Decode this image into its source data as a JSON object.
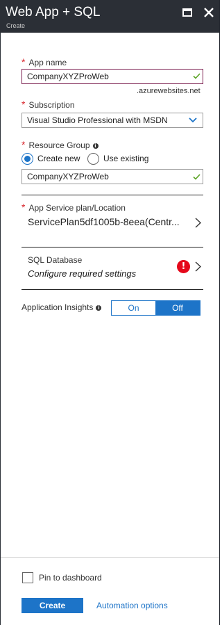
{
  "header": {
    "title": "Web App + SQL",
    "subtitle": "Create"
  },
  "form": {
    "app_name": {
      "label": "App name",
      "value": "CompanyXYZProWeb",
      "suffix": ".azurewebsites.net"
    },
    "subscription": {
      "label": "Subscription",
      "value": "Visual Studio Professional with MSDN"
    },
    "resource_group": {
      "label": "Resource Group",
      "options": [
        "Create new",
        "Use existing"
      ],
      "selected": "Create new",
      "value": "CompanyXYZProWeb"
    },
    "app_service_plan": {
      "label": "App Service plan/Location",
      "value": "ServicePlan5df1005b-8eea(Centr..."
    },
    "sql_database": {
      "label": "SQL Database",
      "value": "Configure required settings",
      "status": "error"
    },
    "app_insights": {
      "label": "Application Insights",
      "on_label": "On",
      "off_label": "Off",
      "selected": "Off"
    }
  },
  "footer": {
    "pin_label": "Pin to dashboard",
    "pin_checked": false,
    "create_label": "Create",
    "automation_label": "Automation options"
  },
  "colors": {
    "header_bg": "#2b2f36",
    "accent": "#1d74c8",
    "required": "#d8242b",
    "error": "#e5081b",
    "valid": "#5ba425"
  }
}
